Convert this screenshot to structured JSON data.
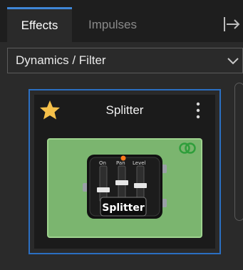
{
  "tabs": [
    {
      "label": "Effects",
      "active": true
    },
    {
      "label": "Impulses",
      "active": false
    }
  ],
  "icons": {
    "dock": "panel-dock-icon",
    "chevron": "chevron-down-icon",
    "favorite": "star-icon",
    "menu": "more-vertical-icon",
    "stereo": "stereo-link-icon"
  },
  "category": {
    "selected": "Dynamics / Filter"
  },
  "effect_card": {
    "title": "Splitter",
    "favorite": true,
    "pedal_label": "Splitter",
    "controls": [
      "On",
      "Pan",
      "Level"
    ]
  },
  "colors": {
    "accent": "#2b6fc2",
    "tile": "#7bb56f",
    "star": "#f5c04a",
    "stereo": "#2f9e3b"
  }
}
